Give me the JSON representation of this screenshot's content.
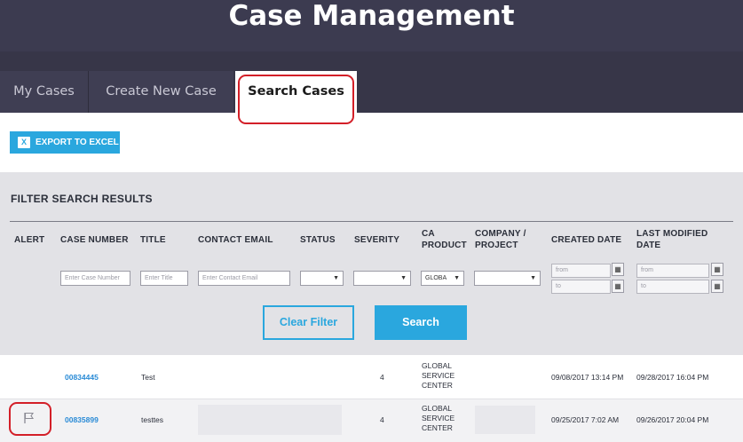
{
  "app": {
    "title": "Case Management"
  },
  "tabs": [
    {
      "label": "My Cases"
    },
    {
      "label": "Create New Case"
    },
    {
      "label": "Search Cases",
      "active": true
    }
  ],
  "toolbar": {
    "export_label": "EXPORT TO EXCEL",
    "export_icon": "excel-icon"
  },
  "filter": {
    "heading": "FILTER SEARCH RESULTS",
    "columns": {
      "alert": "ALERT",
      "case_number": "CASE NUMBER",
      "title": "TITLE",
      "contact_email": "CONTACT EMAIL",
      "status": "STATUS",
      "severity": "SEVERITY",
      "ca_product_1": "CA",
      "ca_product_2": "PRODUCT",
      "company_1": "COMPANY /",
      "company_2": "PROJECT",
      "created_date": "CREATED DATE",
      "modified_1": "LAST MODIFIED",
      "modified_2": "DATE"
    },
    "placeholders": {
      "case_number": "Enter Case Number",
      "title": "Enter Title",
      "contact_email": "Enter Contact Email",
      "from": "from",
      "to": "to"
    },
    "ca_product_value": "GLOBA",
    "clear_label": "Clear Filter",
    "search_label": "Search"
  },
  "rows": [
    {
      "case_number": "00834445",
      "title": "Test",
      "severity": "4",
      "product_1": "GLOBAL",
      "product_2": "SERVICE",
      "product_3": "CENTER",
      "created": "09/08/2017 13:14 PM",
      "modified": "09/28/2017 16:04 PM"
    },
    {
      "alert_icon": "flag-icon",
      "case_number": "00835899",
      "title": "testtes",
      "severity": "4",
      "product_1": "GLOBAL",
      "product_2": "SERVICE",
      "product_3": "CENTER",
      "created": "09/25/2017 7:02 AM",
      "modified": "09/26/2017 20:04 PM"
    }
  ],
  "colors": {
    "header": "#373648",
    "accent": "#2aa7de",
    "highlight": "#d31f28",
    "panel": "#e2e2e6"
  }
}
